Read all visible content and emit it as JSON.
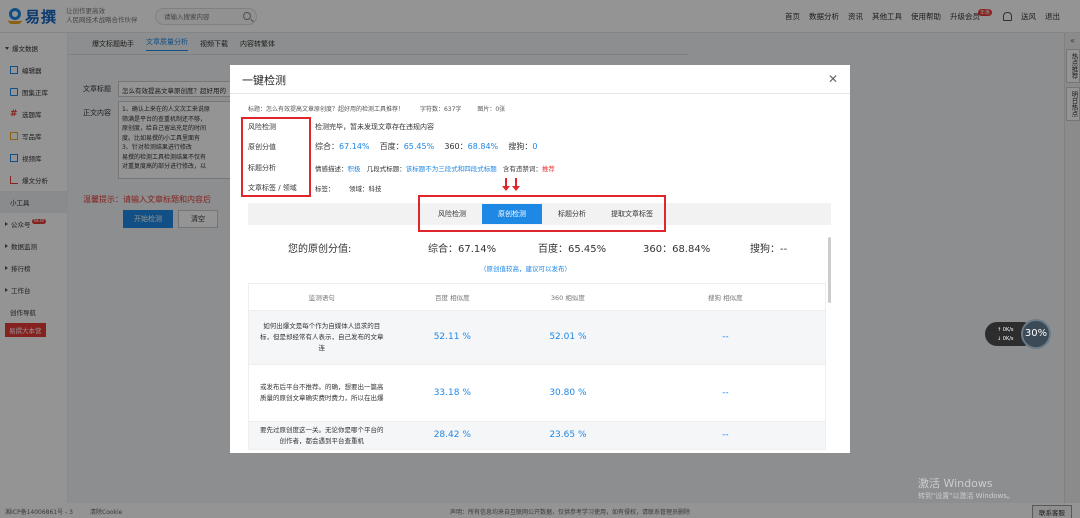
{
  "header": {
    "logo_text": "易撰",
    "slogan_line1": "让创作更高效",
    "slogan_line2": "人民网技术战略合作伙伴",
    "search_placeholder": "请输入搜索内容",
    "nav": [
      "首页",
      "数据分析",
      "资讯",
      "其他工具",
      "使用帮助",
      "升级会员",
      "送风",
      "退出"
    ],
    "vip_badge": "年惠"
  },
  "sidebar": {
    "items": [
      {
        "label": "爆文数据",
        "type": "group"
      },
      {
        "label": "编辑器",
        "type": "sub"
      },
      {
        "label": "图集正库",
        "type": "sub"
      },
      {
        "label": "选题库",
        "type": "sub"
      },
      {
        "label": "写品库",
        "type": "sub"
      },
      {
        "label": "视频库",
        "type": "sub"
      },
      {
        "label": "爆文分析",
        "type": "sub"
      },
      {
        "label": "小工具",
        "type": "active"
      },
      {
        "label": "公众号",
        "type": "group",
        "tag": "NEW"
      },
      {
        "label": "数据监测",
        "type": "group"
      },
      {
        "label": "排行榜",
        "type": "group"
      },
      {
        "label": "工作台",
        "type": "group"
      },
      {
        "label": "创作导航",
        "type": "plain"
      }
    ],
    "cta": "易撰大本营"
  },
  "content": {
    "tabs": [
      "爆文标题助手",
      "文章质量分析",
      "视频下载",
      "内容转繁体"
    ],
    "active_tab": 1,
    "title_label": "文章标题",
    "title_value": "怎么有效提高文章原创度？超好用的",
    "body_label": "正文内容",
    "body_lines": [
      "1、确认上来在的人文次工来说原",
      "筛满是平台的查重机制还不够，",
      "原创度，给自己留出充足的时间",
      "度。比如易撰的小工具里面有",
      "3、针对检测结果进行修改",
      "易撰的检测工具检测结果不仅有",
      "对重复度高的部分进行修改，以"
    ],
    "warn": "温馨提示：请输入文章标题和内容后",
    "start_button": "开始检测",
    "clear_button": "清空"
  },
  "modal": {
    "title": "一键检测",
    "meta_title": "标题：怎么有效提高文章原创度？超好用的检测工具推荐！",
    "meta_count": "字符数：637字",
    "meta_images": "图片：0张",
    "rows": {
      "risk_label": "风险检测",
      "risk_value": "检测完毕，暂未发现文章存在违规内容",
      "orig_label": "原创分值",
      "orig_zh_label": "综合：",
      "orig_zh": "67.14%",
      "orig_bd_label": "百度：",
      "orig_bd": "65.45%",
      "orig_360_label": "360：",
      "orig_360": "68.84%",
      "orig_sg_label": "搜狗：",
      "orig_sg": "0",
      "title_label": "标题分析",
      "emotion_label": "情感描述：",
      "emotion_value": "积极",
      "style_label": "几段式标题：",
      "style_value": "该标题不为三段式和四段式标题",
      "ban_label": "含有违禁词：",
      "ban_value": "推荐",
      "tag_label": "文章标签 / 领域",
      "tag_value": "标签：",
      "domain_value": "领域：科技"
    },
    "subtabs": [
      "风险检测",
      "原创检测",
      "标题分析",
      "提取文章标签"
    ],
    "active_subtab": 1,
    "score_label": "您的原创分值:",
    "score_zh": "综合：67.14%",
    "score_bd": "百度：65.45%",
    "score_360": "360：68.84%",
    "score_sg": "搜狗：--",
    "hint": "（原创值较高，建议可以发布）",
    "table": {
      "headers": [
        "监测语句",
        "百度 相似度",
        "360 相似度",
        "搜狗 相似度"
      ],
      "rows": [
        {
          "text": "如何出爆文是每个作为自媒体人追求的目标，但是却经常有人表示，自己发布的文章连",
          "baidu": "52.11 %",
          "s360": "52.01 %",
          "sogou": "--"
        },
        {
          "text": "或发布后平台不推荐。的确，想要出一篇高质量的原创文章确实费时费力，所以在出爆",
          "baidu": "33.18 %",
          "s360": "30.80 %",
          "sogou": "--"
        },
        {
          "text": "要先过原创度这一关。无论你是哪个平台的创作者，都会遇到平台查重机",
          "baidu": "28.42 %",
          "s360": "23.65 %",
          "sogou": "--"
        }
      ]
    }
  },
  "right_tools": {
    "collapse": "«",
    "tab1": "热点推荐",
    "tab2": "明日热点"
  },
  "speed": {
    "up": "0K/s",
    "down": "0K/s",
    "percent": "30%"
  },
  "watermark": {
    "line1": "激活 Windows",
    "line2": "转到\"设置\"以激活 Windows。"
  },
  "footer": {
    "icp": "湘ICP备14006861号 - 3",
    "cookie": "清除Cookie",
    "disclaimer": "声明：所有信息均来自互联网公开数据，仅供参考学习使用，如有侵权，请联系管理员删除",
    "contact": "联系客服"
  },
  "colors": {
    "accent": "#1e88e5",
    "highlight_box": "#e0262b",
    "warning": "#e53935"
  }
}
